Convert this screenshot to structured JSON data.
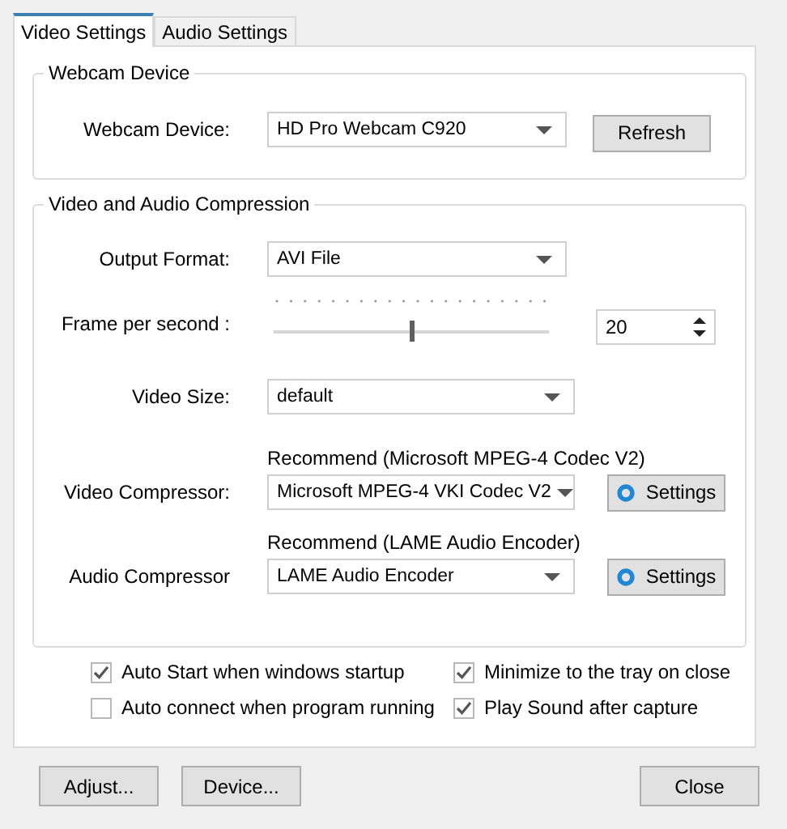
{
  "tabs": [
    {
      "label": "Video Settings",
      "selected": true
    },
    {
      "label": "Audio Settings",
      "selected": false
    }
  ],
  "webcam_group": {
    "title": "Webcam Device",
    "label": "Webcam Device:",
    "value": "HD Pro Webcam C920",
    "button": "Refresh"
  },
  "compression_group": {
    "title": "Video and Audio Compression",
    "output_format": {
      "label": "Output Format:",
      "value": "AVI File"
    },
    "frame_rate": {
      "label": "Frame per second :",
      "level": 0.5,
      "value": "20"
    },
    "video_size": {
      "label": "Video Size:",
      "value": "default"
    },
    "video_compressor": {
      "recommend": "Recommend (Microsoft MPEG-4 Codec V2)",
      "label": "Video Compressor:",
      "value": "Microsoft MPEG-4  VKI  Codec V2",
      "button": "Settings"
    },
    "audio_compressor": {
      "recommend": "Recommend (LAME Audio Encoder)",
      "label": "Audio Compressor",
      "value": "LAME Audio Encoder",
      "button": "Settings"
    }
  },
  "options": [
    {
      "label": "Auto Start when windows startup",
      "checked": true
    },
    {
      "label": "Minimize to the tray on close",
      "checked": true
    },
    {
      "label": "Auto connect when program running",
      "checked": false
    },
    {
      "label": "Play Sound after capture",
      "checked": true
    }
  ],
  "buttons": [
    "Adjust...",
    "Device...",
    "Close"
  ]
}
